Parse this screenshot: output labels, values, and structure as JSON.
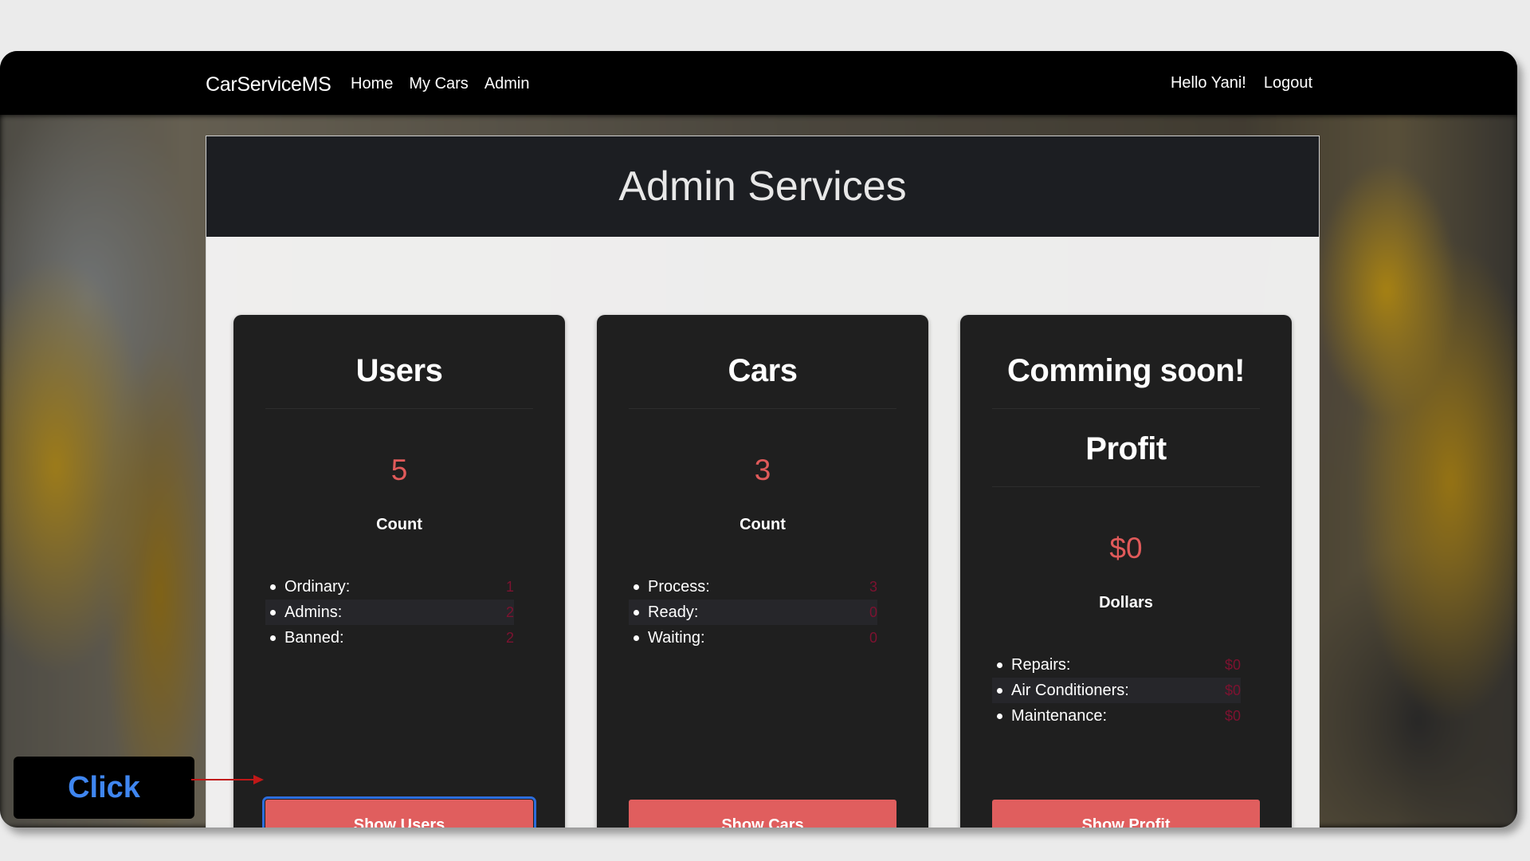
{
  "navbar": {
    "brand": "CarServiceMS",
    "links": [
      {
        "label": "Home"
      },
      {
        "label": "My Cars"
      },
      {
        "label": "Admin"
      }
    ],
    "greeting": "Hello Yani!",
    "logout": "Logout"
  },
  "panel": {
    "title": "Admin Services"
  },
  "cards": [
    {
      "title": "Users",
      "value": "5",
      "value_label": "Count",
      "stats": [
        {
          "label": "Ordinary:",
          "value": "1"
        },
        {
          "label": "Admins:",
          "value": "2"
        },
        {
          "label": "Banned:",
          "value": "2"
        }
      ],
      "button": "Show Users"
    },
    {
      "title": "Cars",
      "value": "3",
      "value_label": "Count",
      "stats": [
        {
          "label": "Process:",
          "value": "3"
        },
        {
          "label": "Ready:",
          "value": "0"
        },
        {
          "label": "Waiting:",
          "value": "0"
        }
      ],
      "button": "Show Cars"
    },
    {
      "title": "Comming soon!",
      "subtitle": "Profit",
      "value": "$0",
      "value_label": "Dollars",
      "stats": [
        {
          "label": "Repairs:",
          "value": "$0"
        },
        {
          "label": "Air Conditioners:",
          "value": "$0"
        },
        {
          "label": "Maintenance:",
          "value": "$0"
        }
      ],
      "button": "Show Profit"
    }
  ],
  "annotation": {
    "label": "Click"
  },
  "colors": {
    "accent": "#e05e5e",
    "value_red": "#e05a5a",
    "stat_value": "#7d1230",
    "highlight": "#2d6ddc",
    "card_bg": "#1f1f1f",
    "header_bg": "#1c1e22"
  }
}
